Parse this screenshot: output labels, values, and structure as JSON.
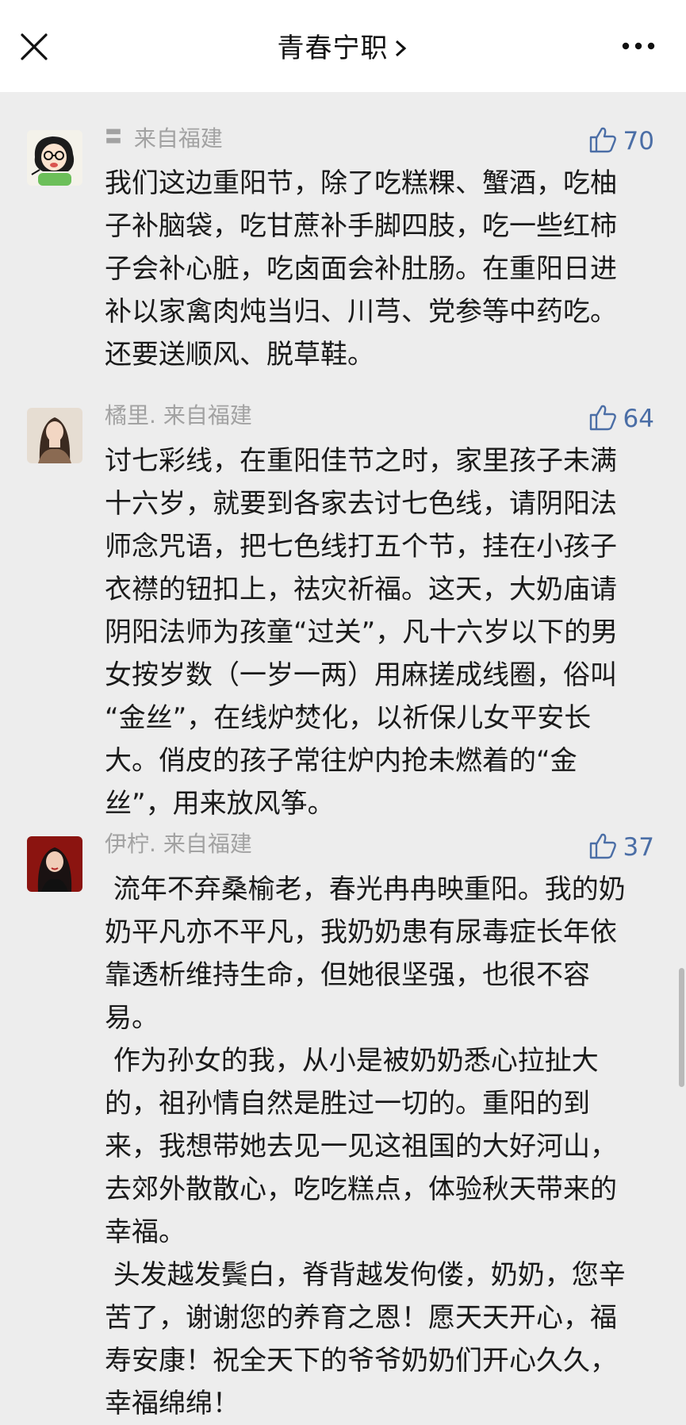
{
  "header": {
    "title": "青春宁职",
    "close_icon": "close-icon",
    "chevron_icon": "chevron-right-icon",
    "more_icon": "more-dots-icon"
  },
  "comments": [
    {
      "name": "",
      "nickname_glyph": "〓",
      "location": "来自福建",
      "likes": "70",
      "avatar_icon": "cartoon-girl-avatar",
      "text": "我们这边重阳节，除了吃糕粿、蟹酒，吃柚\n子补脑袋，吃甘蔗补手脚四肢，吃一些红柿\n子会补心脏，吃卤面会补肚肠。在重阳日进\n补以家禽肉炖当归、川芎、党参等中药吃。\n还要送顺风、脱草鞋。"
    },
    {
      "name": "橘里.",
      "location": "来自福建",
      "likes": "64",
      "avatar_icon": "woman-photo-avatar",
      "text": "讨七彩线，在重阳佳节之时，家里孩子未满\n十六岁，就要到各家去讨七色线，请阴阳法\n师念咒语，把七色线打五个节，挂在小孩子\n衣襟的钮扣上，祛灾祈福。这天，大奶庙请\n阴阳法师为孩童“过关”，凡十六岁以下的男\n女按岁数（一岁一两）用麻搓成线圈，俗叫\n“金丝”，在线炉焚化，以祈保儿女平安长\n大。俏皮的孩子常往炉内抢未燃着的“金\n丝”，用来放风筝。"
    },
    {
      "name": "伊柠.",
      "location": "来自福建",
      "likes": "37",
      "avatar_icon": "woman-red-background-avatar",
      "text": " 流年不弃桑榆老，春光冉冉映重阳。我的奶\n奶平凡亦不平凡，我奶奶患有尿毒症长年依\n靠透析维持生命，但她很坚强，也很不容\n易。\n 作为孙女的我，从小是被奶奶悉心拉扯大\n的，祖孙情自然是胜过一切的。重阳的到\n来，我想带她去见一见这祖国的大好河山，\n去郊外散散心，吃吃糕点，体验秋天带来的\n幸福。\n 头发越发鬓白，脊背越发佝偻，奶奶，您辛\n苦了，谢谢您的养育之恩！愿天天开心，福\n寿安康！祝全天下的爷爷奶奶们开心久久，\n幸福绵绵！"
    }
  ],
  "colors": {
    "background": "#ededed",
    "header_bg": "#ffffff",
    "meta_gray": "#a2a2a2",
    "like_blue": "#4b6ea6"
  }
}
